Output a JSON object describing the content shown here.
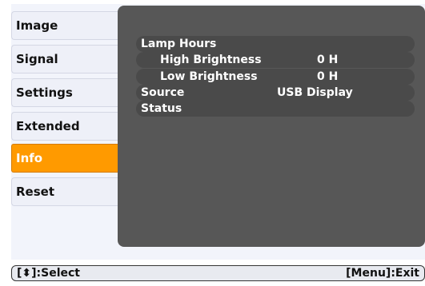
{
  "menu": {
    "items": [
      {
        "label": "Image",
        "active": false
      },
      {
        "label": "Signal",
        "active": false
      },
      {
        "label": "Settings",
        "active": false
      },
      {
        "label": "Extended",
        "active": false
      },
      {
        "label": "Info",
        "active": true
      },
      {
        "label": "Reset",
        "active": false
      }
    ]
  },
  "info": {
    "lamp_hours_label": "Lamp Hours",
    "high_brightness_label": "High Brightness",
    "high_brightness_value": "0 H",
    "low_brightness_label": "Low Brightness",
    "low_brightness_value": "0 H",
    "source_label": "Source",
    "source_value": "USB Display",
    "status_label": "Status"
  },
  "footer": {
    "select_hint": "[⬍]:Select",
    "exit_hint": "[Menu]:Exit"
  },
  "colors": {
    "active_tab": "#ff9a00",
    "panel_background": "#575757",
    "row_bar": "#4a4a4a"
  }
}
